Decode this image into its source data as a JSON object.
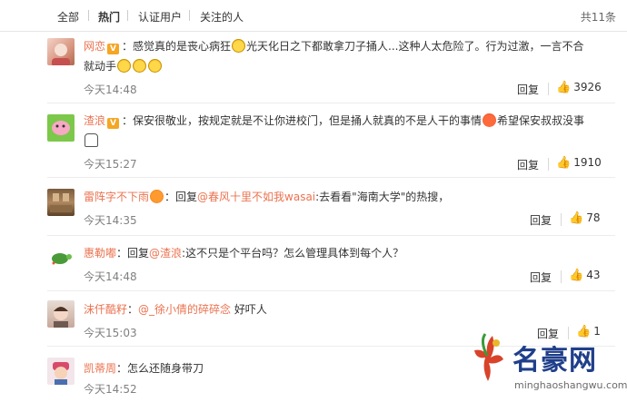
{
  "tabs": [
    "全部",
    "热门",
    "认证用户",
    "关注的人"
  ],
  "total": "共11条",
  "reply_label": "回复",
  "comments": [
    {
      "user": "网恋",
      "vip": "V",
      "text_a": "：感觉真的是丧心病狂",
      "text_b": "光天化日之下都敢拿刀子捅人...这种人太危险了。行为过激，一言不合",
      "text_c": "就动手",
      "time": "今天14:48",
      "likes": "3926"
    },
    {
      "user": "渣浪",
      "vip": "V",
      "text_a": "：保安很敬业，按规定就是不让你进校门，但是捅人就真的不是人干的事情",
      "text_b": "希望保安叔叔没事",
      "time": "今天15:27",
      "likes": "1910"
    },
    {
      "user": "雷阵字不下雨",
      "text_a": "：回复",
      "mention": "@春风十里不如我wasai",
      "text_b": ":去看看\"海南大学\"的热搜，",
      "time": "今天14:35",
      "likes": "78"
    },
    {
      "user": "惠勒嘟",
      "text_a": "：回复",
      "mention": "@渣浪",
      "text_b": ":这不只是个平台吗？怎么管理具体到每个人？",
      "time": "今天14:48",
      "likes": "43"
    },
    {
      "user": "沫仟酷籽",
      "text_a": "：",
      "mention": "@_徐小倩的碎碎念",
      "text_b": " 好吓人",
      "time": "今天15:03",
      "likes": "1"
    },
    {
      "user": "凯蒂周",
      "text_a": "：怎么还随身带刀",
      "time": "今天14:52"
    }
  ],
  "watermark": {
    "name": "名豪网",
    "url": "minghaoshangwu.com"
  },
  "colors": {
    "username": "#eb7350",
    "time": "#808080",
    "watermark": "#1f3f8a"
  }
}
